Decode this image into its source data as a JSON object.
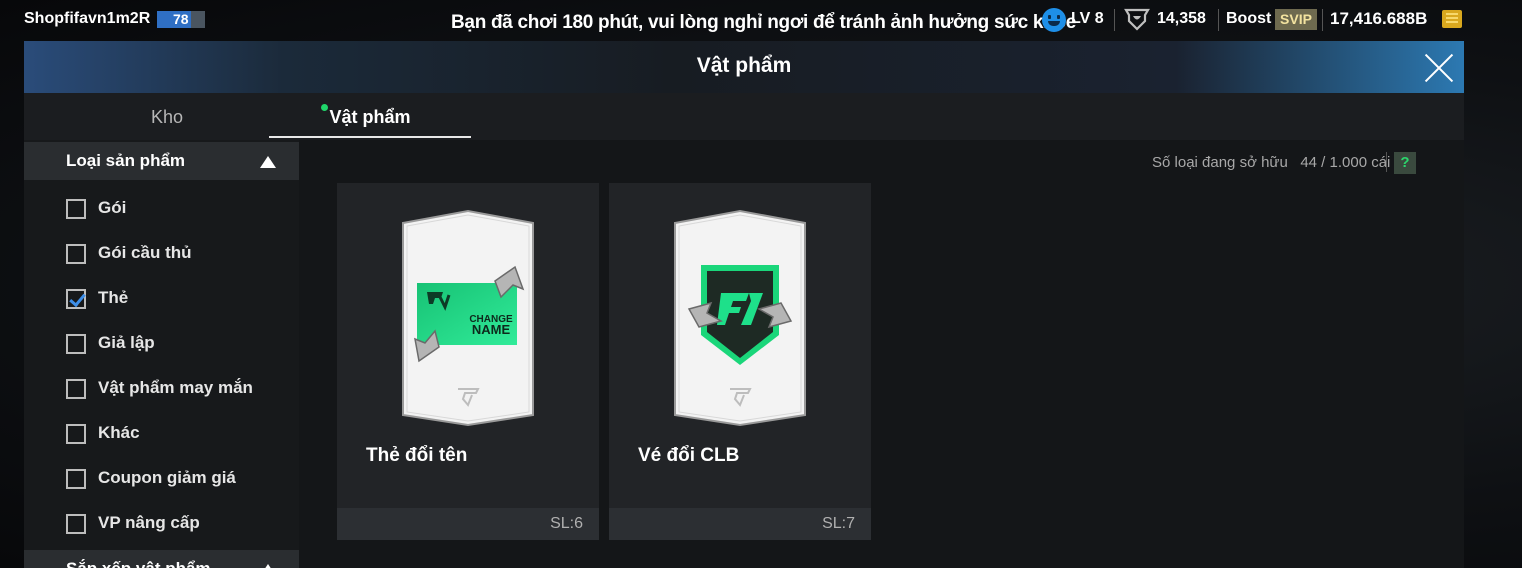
{
  "topbar": {
    "username": "Shopfifavn1m2R",
    "ovr": "78",
    "health_warning": "Bạn đã chơi 180 phút, vui lòng nghỉ ngơi để tránh ảnh hưởng sức khỏe",
    "level": "LV 8",
    "points": "14,358",
    "boost_label": "Boost",
    "svip_label": "SVIP",
    "coins": "17,416.688B"
  },
  "panel": {
    "title": "Vật phẩm",
    "tabs": [
      {
        "label": "Kho",
        "active": false
      },
      {
        "label": "Vật phẩm",
        "active": true
      }
    ]
  },
  "sidebar": {
    "filter_header": "Loại sản phẩm",
    "options": [
      {
        "label": "Gói",
        "checked": false
      },
      {
        "label": "Gói cầu thủ",
        "checked": false
      },
      {
        "label": "Thẻ",
        "checked": true
      },
      {
        "label": "Giả lập",
        "checked": false
      },
      {
        "label": "Vật phẩm may mắn",
        "checked": false
      },
      {
        "label": "Khác",
        "checked": false
      },
      {
        "label": "Coupon giảm giá",
        "checked": false
      },
      {
        "label": "VP nâng cấp",
        "checked": false
      }
    ],
    "sort_header": "Sắp xếp vật phẩm"
  },
  "content": {
    "owned_label": "Số loại đang sở hữu",
    "owned_value": "44 / 1.000 cái",
    "help_label": "?",
    "items": [
      {
        "name": "Thẻ đổi tên",
        "qty": "SL:6",
        "card_line1": "CHANGE",
        "card_line2": "NAME"
      },
      {
        "name": "Vé đổi CLB",
        "qty": "SL:7"
      }
    ]
  },
  "colors": {
    "accent_green": "#1fd66a",
    "check_blue": "#3d8ee8",
    "ovr_blue": "#2f6fc4"
  }
}
